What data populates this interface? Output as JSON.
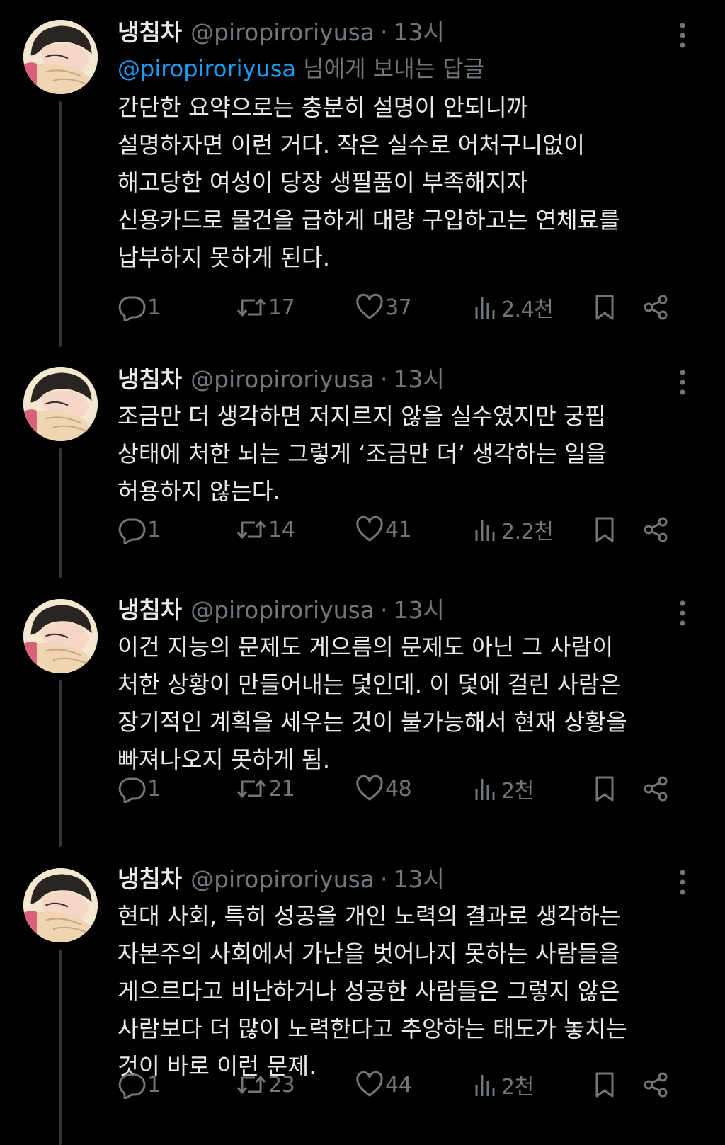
{
  "colors": {
    "background": "#000000",
    "text": "#e7e9ea",
    "secondary": "#71767b",
    "link": "#1d9bf0",
    "thread_line": "#333639"
  },
  "tweets": [
    {
      "name": "냉침차",
      "handle": "@piropiroriyusa",
      "separator": "·",
      "time": "13시",
      "replying_to": {
        "mention": "@piropiroriyusa",
        "suffix": " 님에게 보내는 답글"
      },
      "lines": [
        "간단한 요약으로는 충분히 설명이 안되니까",
        "설명하자면 이런 거다. 작은 실수로 어처구니없이",
        "해고당한 여성이 당장 생필품이 부족해지자",
        "신용카드로 물건을 급하게 대량 구입하고는 연체료를",
        "납부하지 못하게 된다."
      ],
      "stats": {
        "replies": "1",
        "retweets": "17",
        "likes": "37",
        "views": "2.4천"
      }
    },
    {
      "name": "냉침차",
      "handle": "@piropiroriyusa",
      "separator": "·",
      "time": "13시",
      "lines": [
        "조금만 더 생각하면 저지르지 않을 실수였지만 궁핍",
        "상태에 처한 뇌는 그렇게 ‘조금만 더’ 생각하는 일을",
        "허용하지 않는다."
      ],
      "stats": {
        "replies": "1",
        "retweets": "14",
        "likes": "41",
        "views": "2.2천"
      }
    },
    {
      "name": "냉침차",
      "handle": "@piropiroriyusa",
      "separator": "·",
      "time": "13시",
      "lines": [
        "이건 지능의 문제도 게으름의 문제도 아닌 그 사람이",
        "처한 상황이 만들어내는 덫인데. 이 덫에 걸린 사람은",
        "장기적인 계획을 세우는 것이 불가능해서 현재 상황을",
        "빠져나오지 못하게 됨."
      ],
      "stats": {
        "replies": "1",
        "retweets": "21",
        "likes": "48",
        "views": "2천"
      }
    },
    {
      "name": "냉침차",
      "handle": "@piropiroriyusa",
      "separator": "·",
      "time": "13시",
      "lines": [
        "현대 사회, 특히 성공을 개인 노력의 결과로 생각하는",
        "자본주의 사회에서 가난을 벗어나지 못하는 사람들을",
        "게으르다고 비난하거나 성공한 사람들은 그렇지 않은",
        "사람보다 더 많이 노력한다고 추앙하는 태도가 놓치는",
        "것이 바로 이런 문제."
      ],
      "stats": {
        "replies": "1",
        "retweets": "23",
        "likes": "44",
        "views": "2천"
      }
    }
  ],
  "icons": {
    "avatar": "avatar-illustration",
    "more": "more-vertical-icon",
    "reply": "reply-bubble-icon",
    "retweet": "retweet-icon",
    "like": "heart-icon",
    "views": "views-bar-chart-icon",
    "bookmark": "bookmark-icon",
    "share": "share-icon"
  }
}
